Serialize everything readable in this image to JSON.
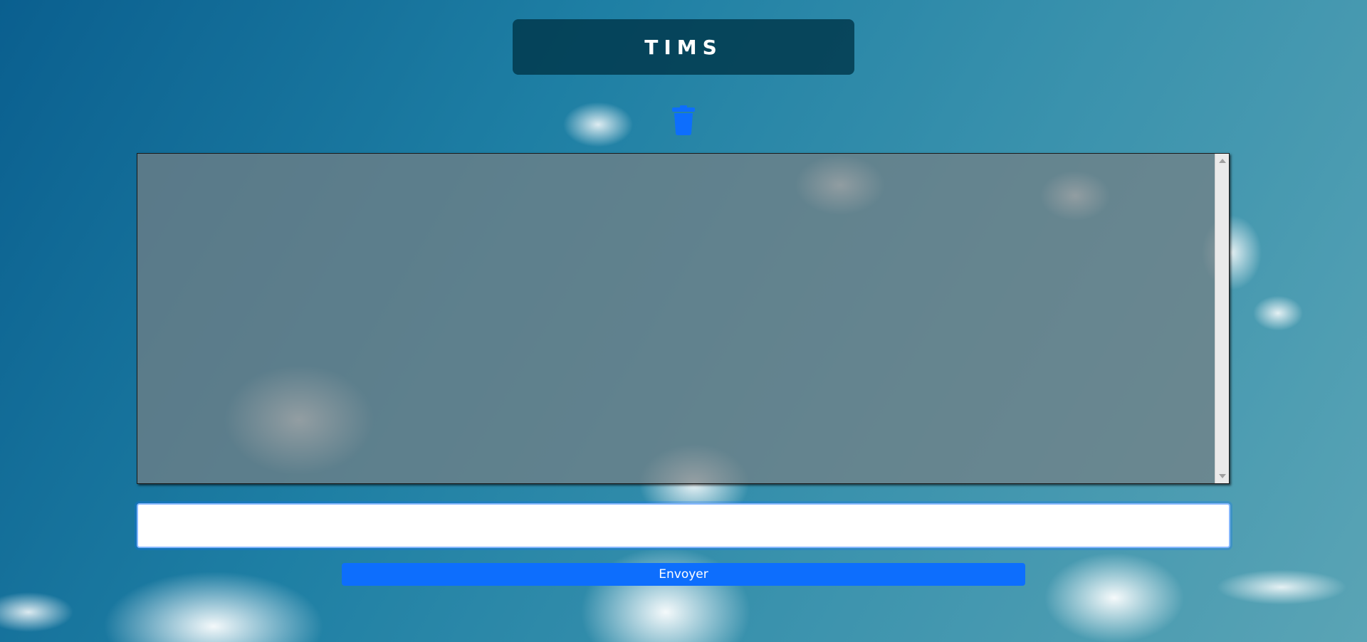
{
  "header": {
    "title": "TIMS"
  },
  "toolbar": {
    "clear_icon": "trash-icon",
    "accent_color": "#0d6efd"
  },
  "chat": {
    "messages": []
  },
  "composer": {
    "input_value": "",
    "input_placeholder": "",
    "send_label": "Envoyer"
  }
}
